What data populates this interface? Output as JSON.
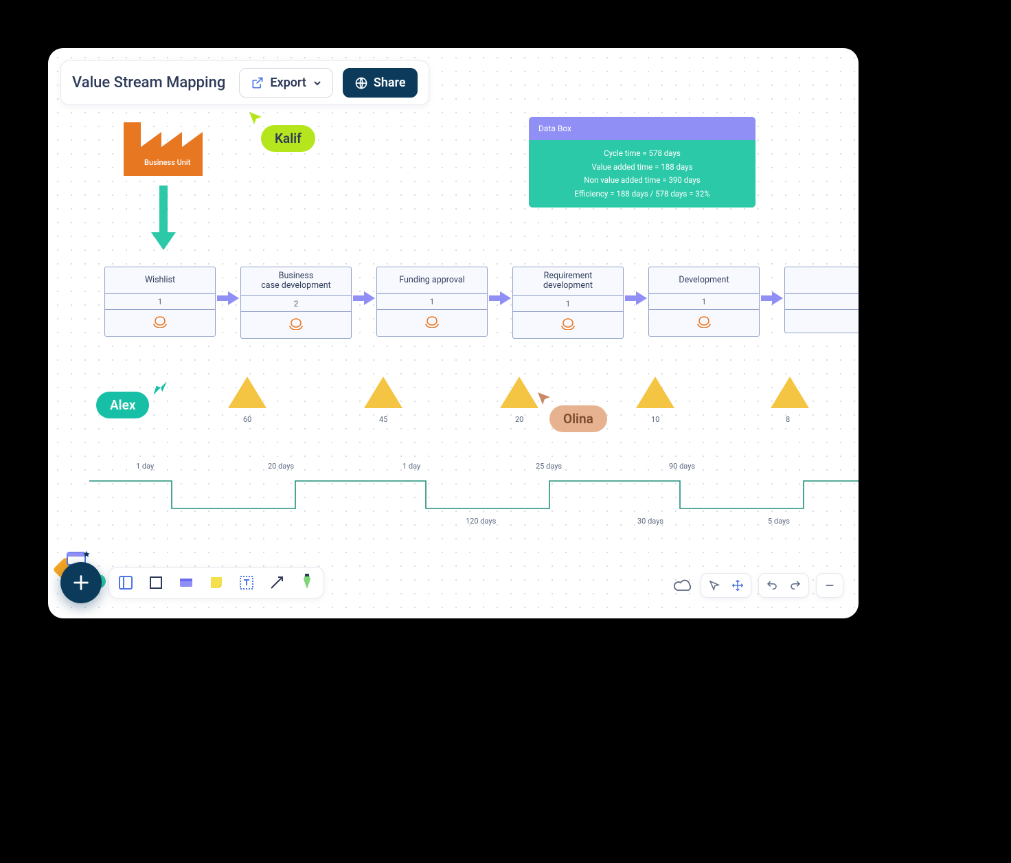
{
  "header": {
    "title": "Value Stream Mapping",
    "export_label": "Export",
    "share_label": "Share"
  },
  "factory": {
    "label": "Business Unit"
  },
  "cursors": {
    "kalif": {
      "name": "Kalif",
      "color": "#b5e61d"
    },
    "alex": {
      "name": "Alex",
      "color": "#17bfa6"
    },
    "olina": {
      "name": "Olina",
      "color": "#e6b28f"
    }
  },
  "databox": {
    "title": "Data Box",
    "lines": [
      "Cycle time = 578 days",
      "Value added time = 188 days",
      "Non value added time = 390 days",
      "Efficiency = 188 days / 578 days = 32%"
    ]
  },
  "processes": [
    {
      "title": "Wishlist",
      "count": "1"
    },
    {
      "title": "Business\ncase development",
      "count": "2"
    },
    {
      "title": "Funding approval",
      "count": "1"
    },
    {
      "title": "Requirement development",
      "count": "1"
    },
    {
      "title": "Development",
      "count": "1"
    }
  ],
  "triangles": [
    {
      "value": "60"
    },
    {
      "value": "45"
    },
    {
      "value": "20"
    },
    {
      "value": "10"
    },
    {
      "value": "8"
    }
  ],
  "timeline_top": [
    {
      "label": "1  day"
    },
    {
      "label": "20  days"
    },
    {
      "label": "1  day"
    },
    {
      "label": "25  days"
    },
    {
      "label": "90  days"
    }
  ],
  "timeline_bottom": [
    {
      "label": "120  days"
    },
    {
      "label": "30  days"
    },
    {
      "label": "5  days"
    }
  ],
  "colors": {
    "brand_dark": "#0b3a5b",
    "orange": "#e87722",
    "teal": "#2cc9a8",
    "violet": "#8f8ff5",
    "yellow": "#f4c542"
  }
}
